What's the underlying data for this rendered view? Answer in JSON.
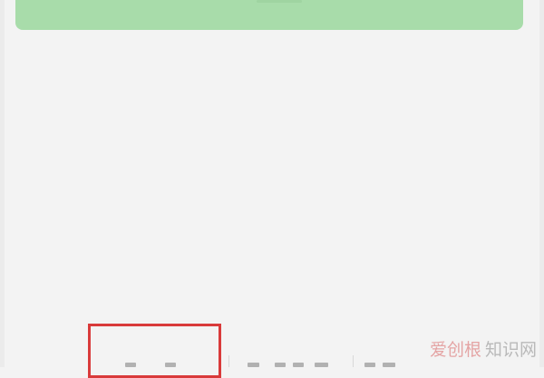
{
  "action_button": {
    "label": "",
    "color": "#a8dcaa"
  },
  "bottom_tabs": [
    {
      "label": ""
    },
    {
      "label": ""
    },
    {
      "label": ""
    }
  ],
  "highlight": {
    "color": "#d93a3a"
  },
  "watermark": {
    "brand_part1": "爱创根",
    "brand_part2": "知识网"
  }
}
